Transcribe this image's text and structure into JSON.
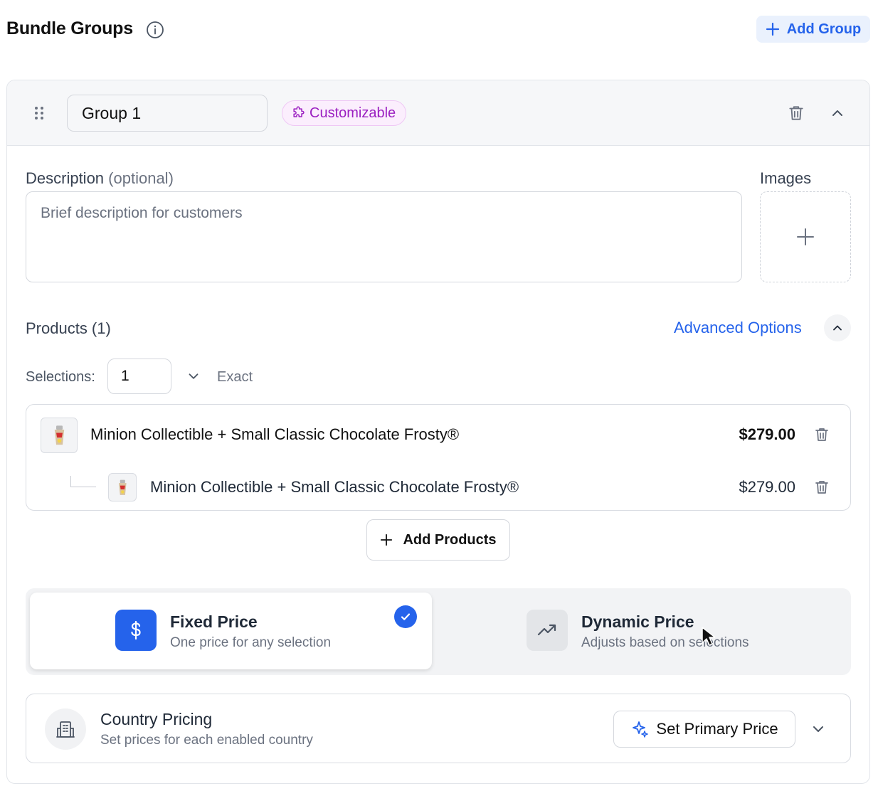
{
  "header": {
    "title": "Bundle Groups",
    "add_group_label": "Add Group",
    "info_icon": "info-icon"
  },
  "group": {
    "name": "Group 1",
    "badge": "Customizable",
    "badge_color": "#9b1fc1",
    "description_label": "Description",
    "description_optional": "(optional)",
    "description_placeholder": "Brief description for customers",
    "images_label": "Images"
  },
  "products": {
    "label": "Products (1)",
    "advanced_options": "Advanced Options",
    "selections_label": "Selections:",
    "selections_value": "1",
    "selection_mode": "Exact",
    "items": [
      {
        "name": "Minion Collectible + Small Classic Chocolate Frosty®",
        "price": "$279.00"
      },
      {
        "name": "Minion Collectible + Small Classic Chocolate Frosty®",
        "price": "$279.00"
      }
    ],
    "add_products_label": "Add Products"
  },
  "pricing": {
    "options": [
      {
        "title": "Fixed Price",
        "subtitle": "One price for any selection",
        "selected": true
      },
      {
        "title": "Dynamic Price",
        "subtitle": "Adjusts based on selections",
        "selected": false
      }
    ],
    "accent": "#2563eb"
  },
  "country_pricing": {
    "title": "Country Pricing",
    "subtitle": "Set prices for each enabled country",
    "primary_button": "Set Primary Price"
  }
}
